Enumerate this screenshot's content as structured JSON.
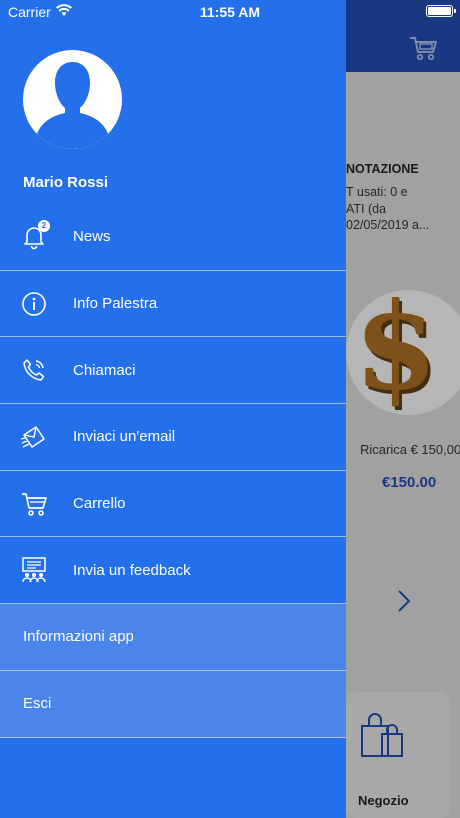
{
  "status_bar": {
    "carrier": "Carrier",
    "time": "11:55 AM"
  },
  "background": {
    "card_title": "NOTAZIONE",
    "card_lines": [
      "T usati: 0 e",
      "ATI (da",
      "02/05/2019 a..."
    ],
    "product_name": "Ricarica € 150,00",
    "product_price": "€150.00",
    "shop_label": "Negozio",
    "header_color": "#1f4aa6"
  },
  "drawer": {
    "bg_color": "#2370ea",
    "user_name": "Mario Rossi",
    "items": [
      {
        "label": "News",
        "icon": "bell-icon",
        "badge": "2"
      },
      {
        "label": "Info Palestra",
        "icon": "info-icon"
      },
      {
        "label": "Chiamaci",
        "icon": "phone-icon"
      },
      {
        "label": "Inviaci un'email",
        "icon": "email-icon"
      },
      {
        "label": "Carrello",
        "icon": "cart-icon"
      },
      {
        "label": "Invia un feedback",
        "icon": "feedback-icon"
      }
    ],
    "plain_items": [
      {
        "label": "Informazioni app"
      },
      {
        "label": "Esci"
      }
    ]
  }
}
